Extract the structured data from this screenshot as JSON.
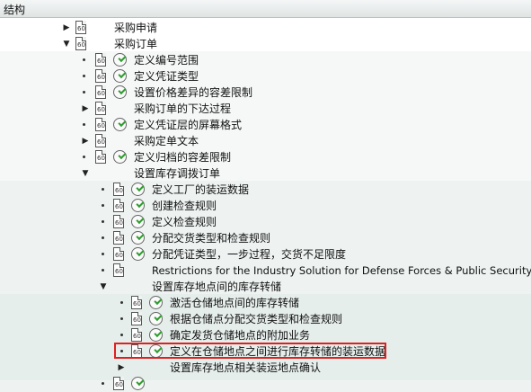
{
  "header": {
    "title": "结构"
  },
  "tree": {
    "items": [
      {
        "label": "采购申请",
        "toggle": "▶"
      },
      {
        "label": "采购订单",
        "toggle": "▼"
      },
      {
        "label": "定义编号范围"
      },
      {
        "label": "定义凭证类型"
      },
      {
        "label": "设置价格差异的容差限制"
      },
      {
        "label": "采购订单的下达过程",
        "toggle": "▶"
      },
      {
        "label": "定义凭证层的屏幕格式"
      },
      {
        "label": "采购定单文本",
        "toggle": "▶"
      },
      {
        "label": "定义归档的容差限制"
      },
      {
        "label": "设置库存调拨订单",
        "toggle": "▼"
      },
      {
        "label": "定义工厂的装运数据"
      },
      {
        "label": "创建检查规则"
      },
      {
        "label": "定义检查规则"
      },
      {
        "label": "分配交货类型和检查规则"
      },
      {
        "label": "分配凭证类型，一步过程，交货不足限度"
      },
      {
        "label": "Restrictions for the Industry Solution for Defense Forces & Public Security"
      },
      {
        "label": "设置库存地点间的库存转储",
        "toggle": "▼"
      },
      {
        "label": "激活仓储地点间的库存转储"
      },
      {
        "label": "根据仓储点分配交货类型和检查规则"
      },
      {
        "label": "确定发货仓储地点的附加业务"
      },
      {
        "label": "定义在仓储地点之间进行库存转储的装运数据"
      },
      {
        "label": "设置库存地点相关装运地点确认",
        "toggle": "▶"
      }
    ]
  }
}
